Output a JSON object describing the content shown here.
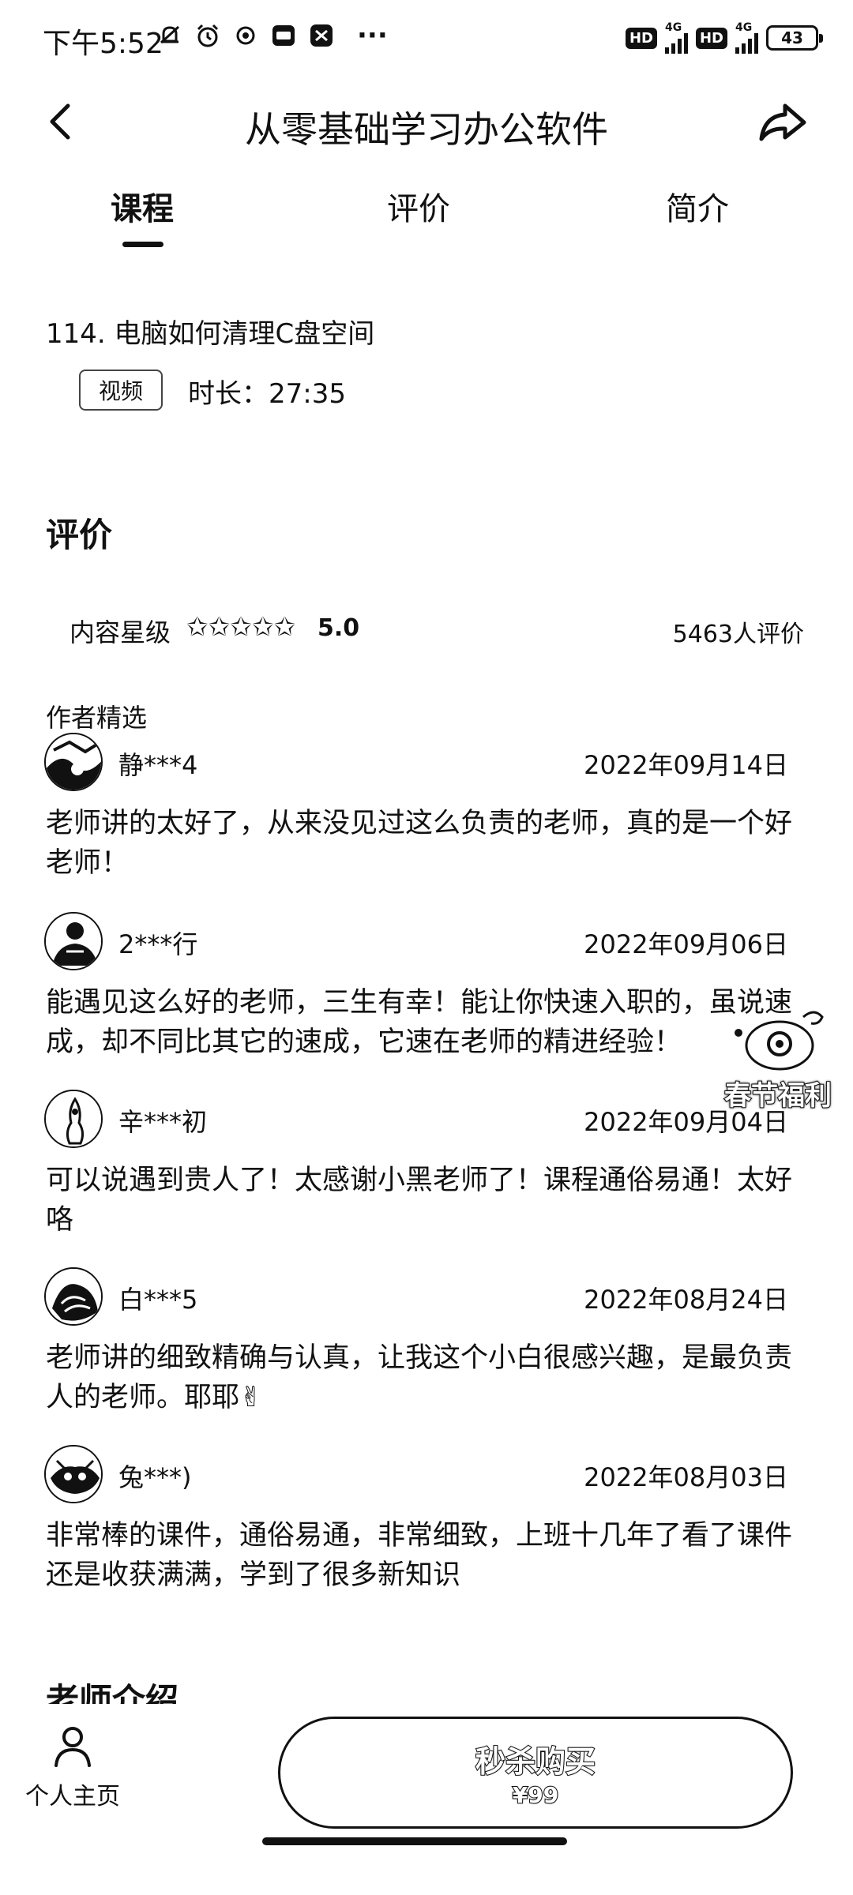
{
  "status_bar": {
    "time": "下午5:52",
    "battery": "43",
    "network1": "4G",
    "network2": "4G",
    "hd": "HD"
  },
  "header": {
    "title": "从零基础学习办公软件",
    "icons": [
      "back-arrow-icon",
      "share-icon"
    ]
  },
  "tabs": [
    {
      "label": "课程",
      "active": true
    },
    {
      "label": "评价",
      "active": false
    },
    {
      "label": "简介",
      "active": false
    }
  ],
  "lesson": {
    "title": "114. 电脑如何清理C盘空间",
    "type_badge": "视频",
    "duration": "时长：27:35"
  },
  "reviews_section": {
    "title": "评价",
    "rating_label": "内容星级",
    "stars": "✩✩✩✩✩",
    "score": "5.0",
    "rating_count": "5463人评价",
    "picked_label": "作者精选",
    "items": [
      {
        "name": "静***4",
        "date": "2022年09月14日",
        "text": "老师讲的太好了，从来没见过这么负责的老师，真的是一个好老师！"
      },
      {
        "name": "2***行",
        "date": "2022年09月06日",
        "text": "能遇见这么好的老师，三生有幸！能让你快速入职的，虽说速成，却不同比其它的速成，它速在老师的精进经验！"
      },
      {
        "name": "辛***初",
        "date": "2022年09月04日",
        "text": "可以说遇到贵人了！太感谢小黑老师了！课程通俗易通！太好咯"
      },
      {
        "name": "白***5",
        "date": "2022年08月24日",
        "text": "老师讲的细致精确与认真，让我这个小白很感兴趣，是最负责人的老师。耶耶✌"
      },
      {
        "name": "兔***)",
        "date": "2022年08月03日",
        "text": "非常棒的课件，通俗易通，非常细致，上班十几年了看了课件还是收获满满，学到了很多新知识"
      }
    ]
  },
  "promo": {
    "label": "春节福利"
  },
  "teacher_section": {
    "title": "老师介绍"
  },
  "bottom_bar": {
    "home_label": "个人主页",
    "buy_label": "秒杀购买",
    "buy_price": "¥99"
  }
}
